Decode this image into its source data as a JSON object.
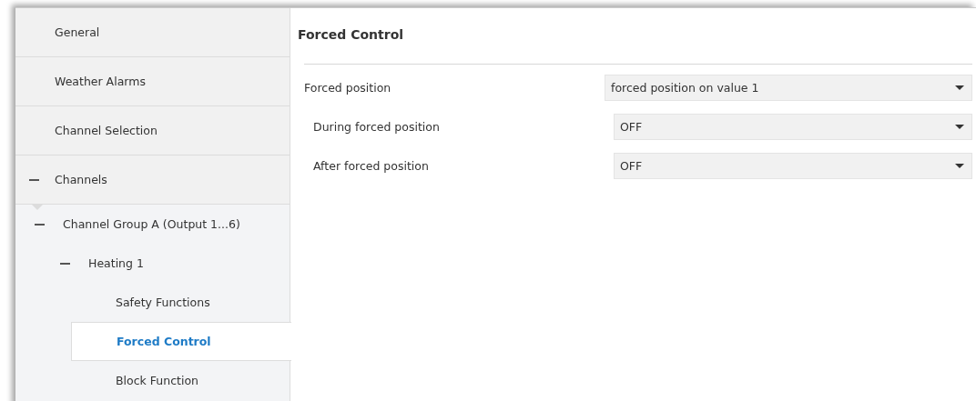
{
  "sidebar": {
    "items": [
      {
        "label": "General",
        "selected": false
      },
      {
        "label": "Weather Alarms",
        "selected": false
      },
      {
        "label": "Channel Selection",
        "selected": false
      },
      {
        "label": "Channels",
        "selected": false,
        "expanded": true,
        "children": [
          {
            "label": "Channel Group A (Output 1...6)",
            "selected": false,
            "expanded": true,
            "children": [
              {
                "label": "Heating 1",
                "selected": false,
                "expanded": true,
                "children": [
                  {
                    "label": "Safety Functions",
                    "selected": false
                  },
                  {
                    "label": "Forced Control",
                    "selected": true
                  },
                  {
                    "label": "Block Function",
                    "selected": false
                  }
                ]
              }
            ]
          }
        ]
      }
    ]
  },
  "panel": {
    "title": "Forced Control",
    "parameters": [
      {
        "label": "Forced position",
        "value": "forced position on value 1",
        "children": [
          {
            "label": "During forced position",
            "value": "OFF"
          },
          {
            "label": "After forced position",
            "value": "OFF"
          }
        ]
      }
    ]
  }
}
